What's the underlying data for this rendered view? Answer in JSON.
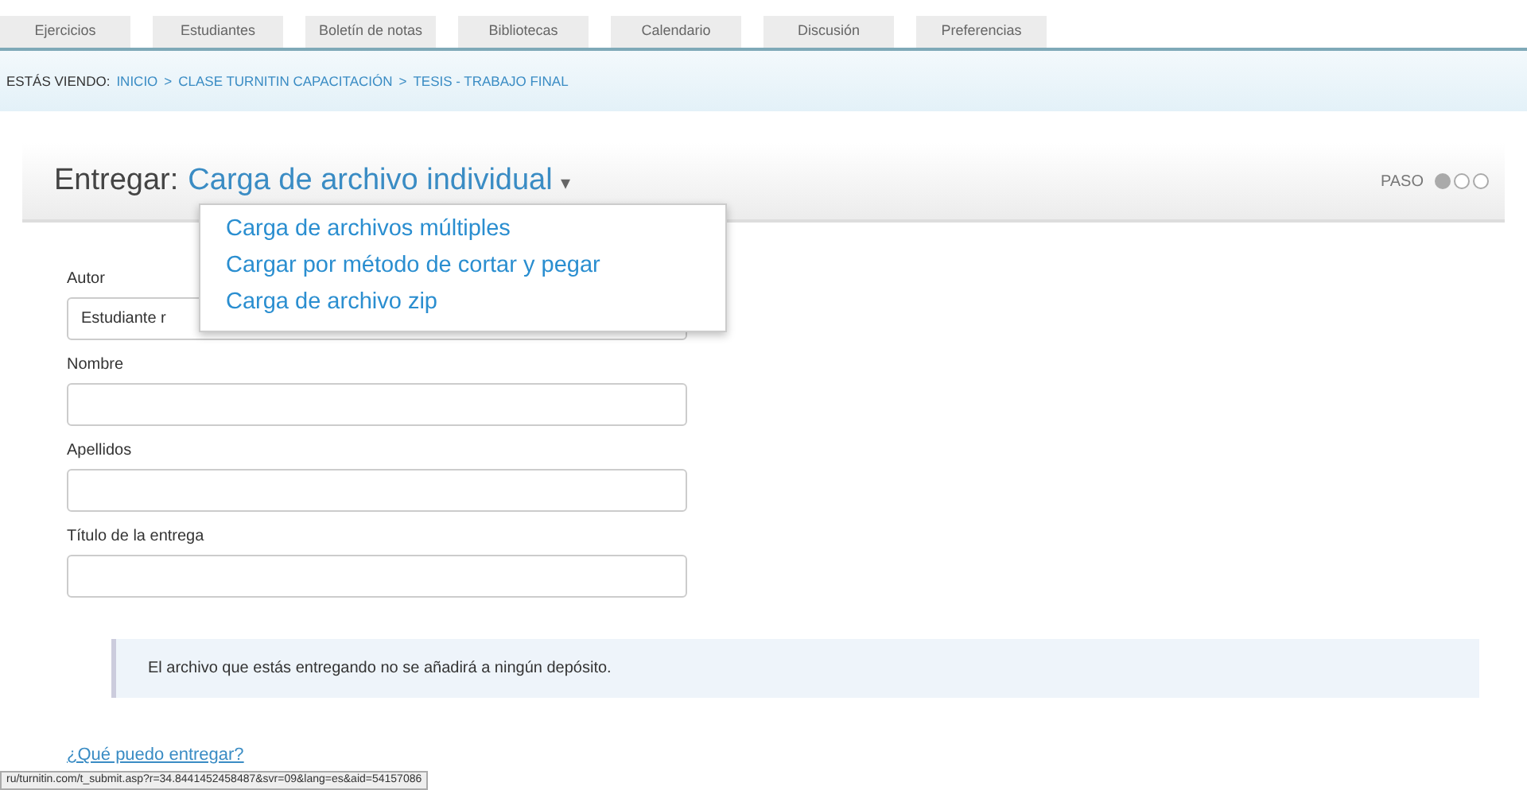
{
  "tabs": [
    {
      "label": "Ejercicios",
      "selected": false
    },
    {
      "label": "Estudiantes",
      "selected": false
    },
    {
      "label": "Boletín de notas",
      "selected": false
    },
    {
      "label": "Bibliotecas",
      "selected": false
    },
    {
      "label": "Calendario",
      "selected": false
    },
    {
      "label": "Discusión",
      "selected": false
    },
    {
      "label": "Preferencias",
      "selected": false
    }
  ],
  "breadcrumb": {
    "prefix": "ESTÁS VIENDO:",
    "items": [
      "INICIO",
      "CLASE TURNITIN CAPACITACIÓN",
      "TESIS - TRABAJO FINAL"
    ],
    "separator": ">"
  },
  "header": {
    "label": "Entregar:",
    "mode": "Carga de archivo individual",
    "caret": "▾",
    "step_label": "PASO",
    "steps": [
      {
        "selected": true
      },
      {
        "selected": false
      },
      {
        "selected": false
      }
    ]
  },
  "dropdown": {
    "items": [
      "Carga de archivos múltiples",
      "Cargar por método de cortar y pegar",
      "Carga de archivo zip"
    ]
  },
  "form": {
    "fields": [
      {
        "label": "Autor",
        "value": "Estudiante r"
      },
      {
        "label": "Nombre"
      },
      {
        "label": "Apellidos"
      },
      {
        "label": "Título de la entrega"
      }
    ]
  },
  "notice": "El archivo que estás entregando no se añadirá a ningún depósito.",
  "help_link": "¿Qué puedo entregar?",
  "status_bar": "ru/turnitin.com/t_submit.asp?r=34.8441452458487&svr=09&lang=es&aid=54157086"
}
